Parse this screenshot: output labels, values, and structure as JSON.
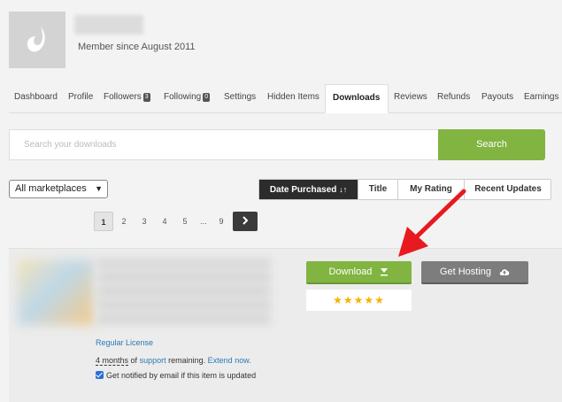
{
  "profile": {
    "member_since": "Member since August 2011"
  },
  "tabs": [
    {
      "label": "Dashboard"
    },
    {
      "label": "Profile"
    },
    {
      "label": "Followers",
      "badge": "3"
    },
    {
      "label": "Following",
      "badge": "0"
    },
    {
      "label": "Settings"
    },
    {
      "label": "Hidden Items"
    },
    {
      "label": "Downloads",
      "active": true
    },
    {
      "label": "Reviews"
    },
    {
      "label": "Refunds"
    },
    {
      "label": "Payouts"
    },
    {
      "label": "Earnings"
    }
  ],
  "search": {
    "placeholder": "Search your downloads",
    "button_label": "Search"
  },
  "filter": {
    "marketplace_selected": "All marketplaces"
  },
  "sort": {
    "items": [
      "Date Purchased",
      "Title",
      "My Rating",
      "Recent Updates"
    ],
    "active": "Date Purchased"
  },
  "pagination": {
    "pages": [
      "1",
      "2",
      "3",
      "4",
      "5",
      "...",
      "9"
    ],
    "current": "1"
  },
  "item": {
    "download_label": "Download",
    "hosting_label": "Get Hosting",
    "rating_stars": "★★★★★",
    "license": "Regular License",
    "support_duration": "4 months",
    "support_of": "of",
    "support_link": "support",
    "support_remaining": "remaining.",
    "extend_link": "Extend now.",
    "notify_label": "Get notified by email if this item is updated"
  },
  "colors": {
    "accent_green": "#81b441",
    "link_blue": "#2a7ab6",
    "annotation_red": "#e8191f"
  }
}
